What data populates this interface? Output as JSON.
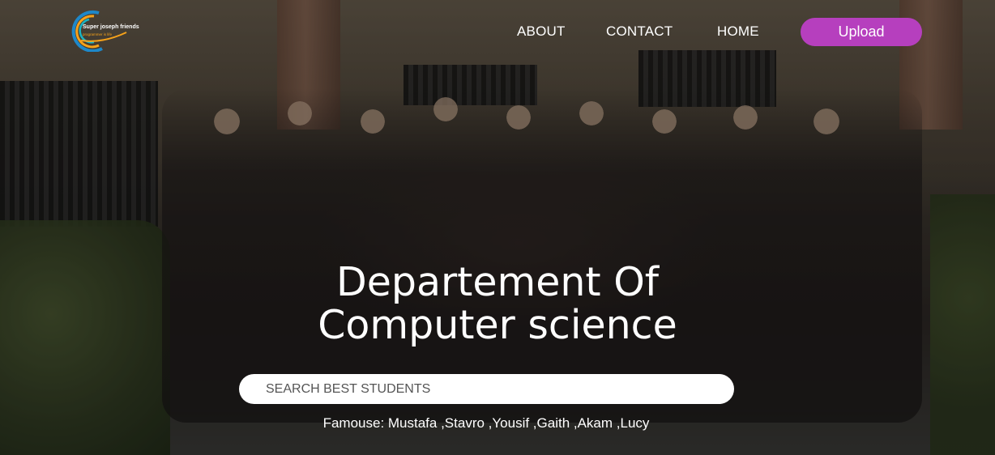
{
  "brand": {
    "logo_line1": "Super joseph friends",
    "logo_line2": "programmer is life"
  },
  "nav": {
    "items": [
      "ABOUT",
      "CONTACT",
      "HOME"
    ],
    "upload_label": "Upload"
  },
  "hero": {
    "headline_line1": "Departement Of",
    "headline_line2": "Computer science"
  },
  "search": {
    "placeholder": "SEARCH BEST STUDENTS"
  },
  "famous_text": "Famouse: Mustafa ,Stavro ,Yousif ,Gaith ,Akam ,Lucy",
  "colors": {
    "accent": "#b63fbe"
  }
}
